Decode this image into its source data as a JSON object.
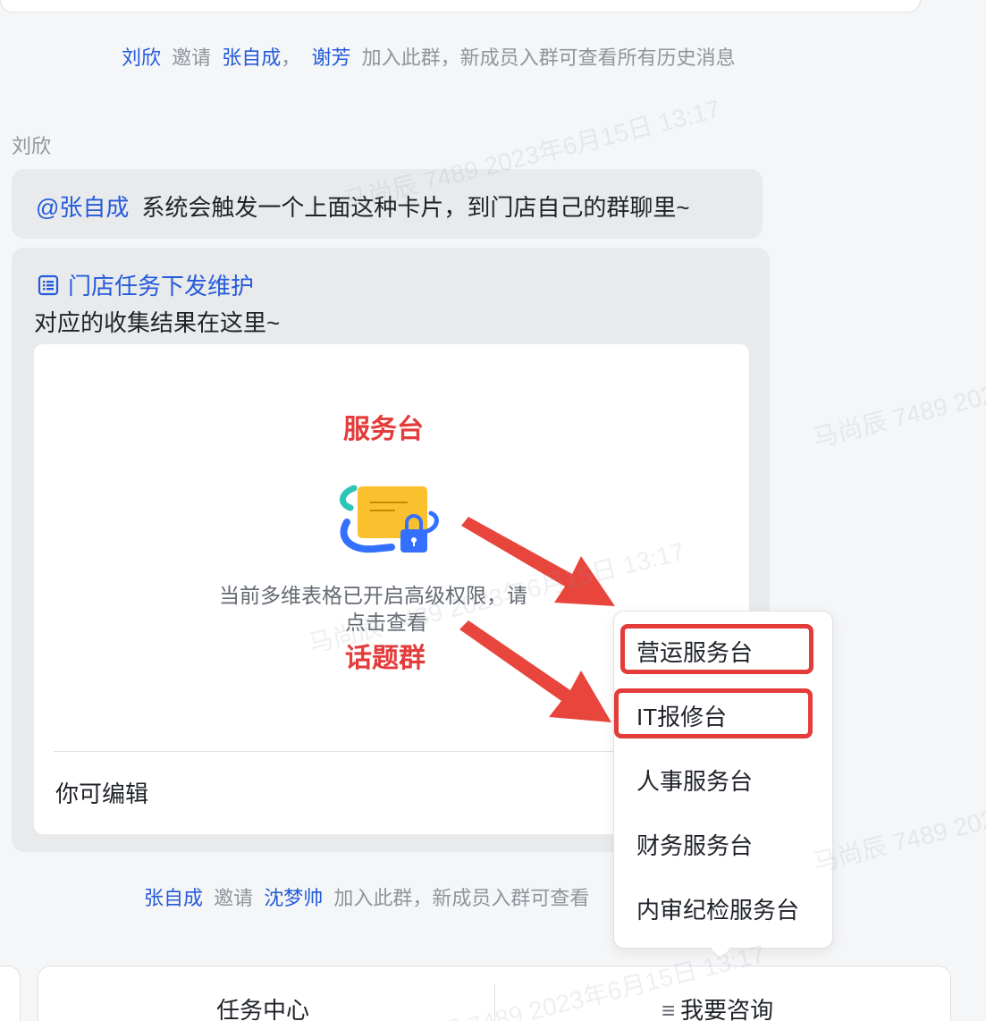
{
  "system_messages": {
    "first": {
      "inviter": "刘欣",
      "verb": "邀请",
      "invitee1": "张自成",
      "sep": "，",
      "invitee2": "谢芳",
      "tail": "加入此群，新成员入群可查看所有历史消息"
    },
    "second": {
      "inviter": "张自成",
      "verb": "邀请",
      "invitee": "沈梦帅",
      "tail": "加入此群，新成员入群可查看"
    }
  },
  "sender_name": "刘欣",
  "message1": {
    "mention": "@张自成",
    "text": "系统会触发一个上面这种卡片，到门店自己的群聊里~"
  },
  "message2": {
    "doc_title": "门店任务下发维护",
    "subtitle": "对应的收集结果在这里~",
    "card": {
      "label_top": "服务台",
      "permission_text": "当前多维表格已开启高级权限，请",
      "click_text": "点击查看",
      "label_bottom": "话题群",
      "footer": "你可编辑"
    }
  },
  "menu": {
    "items": [
      "营运服务台",
      "IT报修台",
      "人事服务台",
      "财务服务台",
      "内审纪检服务台"
    ]
  },
  "bottom_bar": {
    "left_tab": "任务中心",
    "right_icon": "≡",
    "right_tab": "我要咨询"
  },
  "watermark": "马尚辰 7489 2023年6月15日 13:17",
  "colors": {
    "link": "#245bdb",
    "annotation_red": "#e43b3b",
    "bubble": "#e9eaec",
    "page_bg": "#f5f6f7"
  },
  "icons": [
    "document-list-icon",
    "locked-table-illustration",
    "red-arrow-annotation"
  ]
}
